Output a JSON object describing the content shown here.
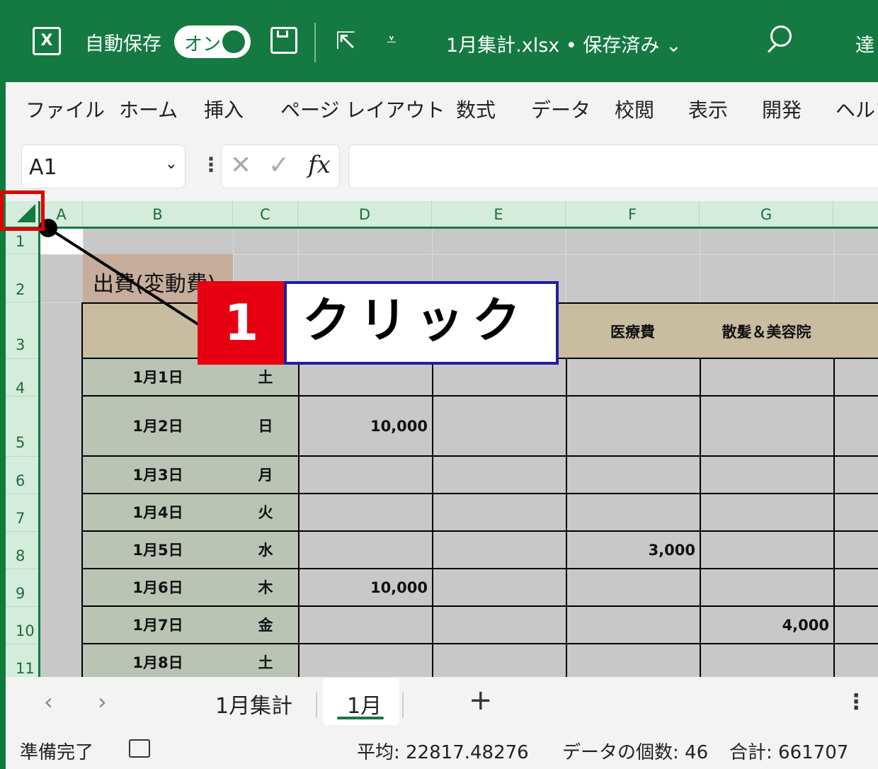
{
  "titlebar": {
    "autosave_label": "自動保存",
    "toggle_label": "オン",
    "file_title": "1月集計.xlsx • 保存済み ⌄",
    "user_name": "達"
  },
  "ribbon": {
    "tabs": [
      "ファイル",
      "ホーム",
      "挿入",
      "ページ レイアウト",
      "数式",
      "データ",
      "校閲",
      "表示",
      "開発",
      "ヘルプ"
    ]
  },
  "formula_bar": {
    "name_box": "A1",
    "formula": ""
  },
  "columns": [
    "A",
    "B",
    "C",
    "D",
    "E",
    "F",
    "G"
  ],
  "rows": [
    "1",
    "2",
    "3",
    "4",
    "5",
    "6",
    "7",
    "8",
    "9",
    "10",
    "11"
  ],
  "sheet": {
    "title": "出費(変動費)",
    "header_f": "医療費",
    "header_g": "散髪＆美容院",
    "data_rows": [
      {
        "date": "1月1日",
        "day": "土",
        "d": "",
        "f": "",
        "g": ""
      },
      {
        "date": "1月2日",
        "day": "日",
        "d": "10,000",
        "f": "",
        "g": ""
      },
      {
        "date": "1月3日",
        "day": "月",
        "d": "",
        "f": "",
        "g": ""
      },
      {
        "date": "1月4日",
        "day": "火",
        "d": "",
        "f": "",
        "g": ""
      },
      {
        "date": "1月5日",
        "day": "水",
        "d": "",
        "f": "3,000",
        "g": ""
      },
      {
        "date": "1月6日",
        "day": "木",
        "d": "10,000",
        "f": "",
        "g": ""
      },
      {
        "date": "1月7日",
        "day": "金",
        "d": "",
        "f": "",
        "g": "4,000"
      },
      {
        "date": "1月8日",
        "day": "土",
        "d": "",
        "f": "",
        "g": ""
      }
    ]
  },
  "annotation": {
    "step": "1",
    "label": "クリック"
  },
  "sheet_tabs": {
    "tab1": "1月集計",
    "tab2": "1月",
    "add": "+"
  },
  "status": {
    "ready": "準備完了",
    "average": "平均: 22817.48276",
    "count": "データの個数: 46",
    "sum": "合計: 661707"
  },
  "colors": {
    "excel_green": "#147a41",
    "header_fill": "#d3ecdc",
    "highlight_red": "#e00000",
    "callout_blue": "#1f1fa0"
  }
}
